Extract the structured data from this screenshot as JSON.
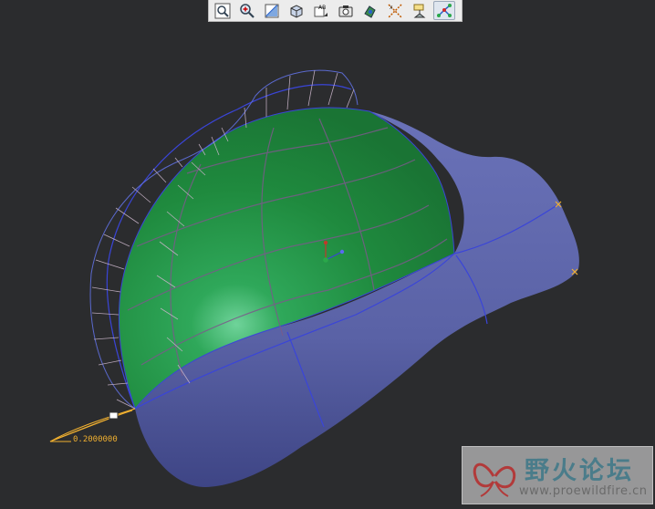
{
  "toolbar": {
    "buttons": [
      {
        "name": "refit-view-button",
        "icon": "zoom-fit-icon"
      },
      {
        "name": "zoom-in-button",
        "icon": "zoom-in-icon"
      },
      {
        "name": "repaint-button",
        "icon": "repaint-icon"
      },
      {
        "name": "display-style-button",
        "icon": "display-style-icon"
      },
      {
        "name": "saved-views-button",
        "icon": "saved-views-icon"
      },
      {
        "name": "screenshot-button",
        "icon": "camera-icon"
      },
      {
        "name": "spin-center-button",
        "icon": "spin-center-icon"
      },
      {
        "name": "datum-display-button",
        "icon": "datum-display-icon"
      },
      {
        "name": "annotation-display-button",
        "icon": "annotation-icon"
      },
      {
        "name": "curve-analysis-button",
        "icon": "curve-analysis-icon"
      }
    ],
    "active_index": 9
  },
  "model": {
    "dimension_value": "0.2000000",
    "surface_colors": {
      "body": "#5c63a8",
      "selected_surface": "#1f8a3e",
      "edges": "#3a45d8",
      "curvature_comb": "#c8b4c8",
      "datum_markers": "#f0b030"
    }
  },
  "watermark": {
    "title": "野火论坛",
    "url": "www.proewildfire.cn"
  }
}
